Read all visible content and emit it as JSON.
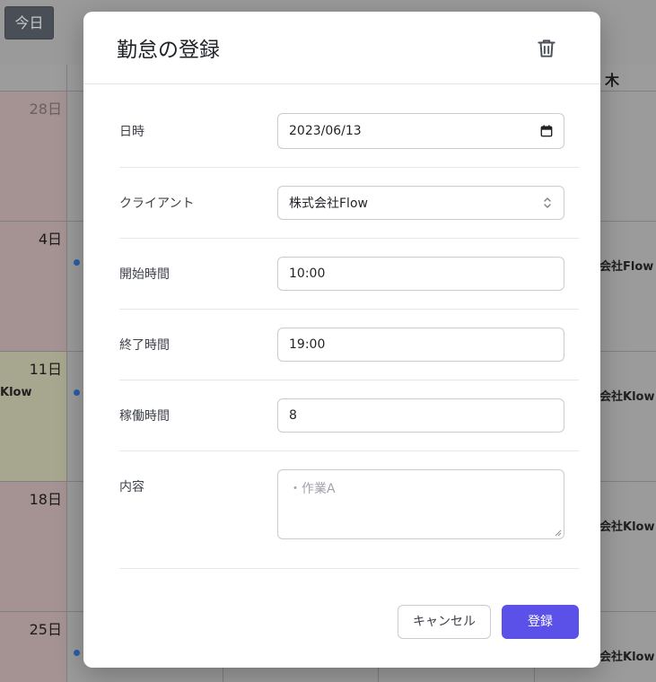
{
  "calendar": {
    "today_label": "今日",
    "weekday_thu": "木",
    "days": {
      "d28": "28日",
      "d4": "4日",
      "d11": "11日",
      "d18": "18日",
      "d25": "25日"
    },
    "events": {
      "left_11": "Klow",
      "right_4": "会社Flow",
      "right_11": "会社Klow",
      "right_18": "会社Klow",
      "right_25": "会社Klow"
    }
  },
  "modal": {
    "title": "勤怠の登録",
    "fields": {
      "date": {
        "label": "日時",
        "value": "2023/06/13"
      },
      "client": {
        "label": "クライアント",
        "value": "株式会社Flow"
      },
      "start": {
        "label": "開始時間",
        "value": "10:00"
      },
      "end": {
        "label": "終了時間",
        "value": "19:00"
      },
      "hours": {
        "label": "稼働時間",
        "value": "8"
      },
      "content": {
        "label": "内容",
        "placeholder": "・作業A"
      }
    },
    "buttons": {
      "cancel": "キャンセル",
      "submit": "登録"
    }
  },
  "colors": {
    "accent": "#5b50e8",
    "event_dot": "#2a5fa8"
  },
  "icons": {
    "delete": "trash-icon",
    "date_picker": "calendar-icon",
    "select": "chevron-updown-icon"
  }
}
